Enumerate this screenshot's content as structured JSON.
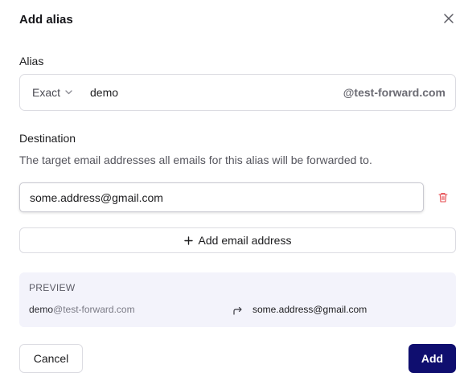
{
  "dialog": {
    "title": "Add alias"
  },
  "alias": {
    "label": "Alias",
    "mode": "Exact",
    "value": "demo",
    "domain": "@test-forward.com"
  },
  "destination": {
    "label": "Destination",
    "help_text": "The target email addresses all emails for this alias will be forwarded to.",
    "addresses": [
      "some.address@gmail.com"
    ],
    "add_button_label": "Add email address"
  },
  "preview": {
    "heading": "PREVIEW",
    "from_local": "demo",
    "from_domain": "@test-forward.com",
    "to": "some.address@gmail.com"
  },
  "footer": {
    "cancel_label": "Cancel",
    "submit_label": "Add"
  },
  "colors": {
    "primary": "#0f0e6f",
    "preview_background": "#f3f3fb",
    "delete_icon": "#e5484d"
  },
  "icons": {
    "close": "close-icon",
    "mode_dropdown": "chevron-down-icon",
    "delete": "trash-icon",
    "add": "plus-icon",
    "forward": "forward-arrow-icon"
  }
}
